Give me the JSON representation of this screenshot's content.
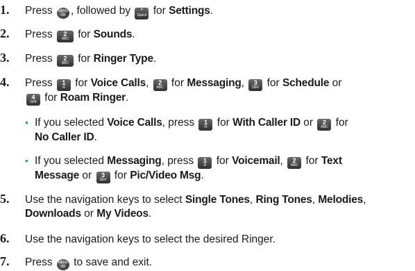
{
  "steps": [
    {
      "n": "1.",
      "t1": "Press ",
      "t2": ", followed by ",
      "t3": " for ",
      "b1": "Settings",
      "t4": "."
    },
    {
      "n": "2.",
      "t1": "Press ",
      "t2": " for ",
      "b1": "Sounds",
      "t3": "."
    },
    {
      "n": "3.",
      "t1": "Press ",
      "t2": " for ",
      "b1": "Ringer Type",
      "t3": "."
    },
    {
      "n": "4.",
      "t1": "Press ",
      "t2": " for ",
      "b1": "Voice Calls",
      "t3": ", ",
      "t4": " for ",
      "b2": "Messaging",
      "t5": ", ",
      "t6": " for ",
      "b3": "Schedule",
      "t7": " or",
      "t8": " for ",
      "b4": "Roam Ringer",
      "t9": "."
    },
    {
      "n": "5.",
      "t1": "Use the navigation keys to select ",
      "b1": "Single Tones",
      "t2": ", ",
      "b2": "Ring Tones",
      "t3": ", ",
      "b3": "Melodies",
      "t4": ",",
      "b4": "Downloads",
      "t5": " or ",
      "b5": "My Videos",
      "t6": "."
    },
    {
      "n": "6.",
      "t1": "Use the navigation keys to select the desired Ringer."
    },
    {
      "n": "7.",
      "t1": "Press ",
      "t2": " to save and exit."
    }
  ],
  "subs": [
    {
      "t1": "If you selected ",
      "b1": "Voice Calls",
      "t2": ", press ",
      "t3": " for ",
      "b2": "With Caller ID",
      "t4": " or ",
      "t5": " for",
      "b3": "No Caller ID",
      "t6": "."
    },
    {
      "t1": "If you selected ",
      "b1": "Messaging",
      "t2": ", press ",
      "t3": " for ",
      "b2": "Voicemail",
      "t4": ", ",
      "t5": " for ",
      "b3": "Text",
      "b4": "Message",
      "t6": " or ",
      "t7": " for ",
      "b5": "Pic/Video Msg",
      "t8": "."
    }
  ],
  "keys": {
    "menu_top": "MENU",
    "menu_bottom": "OK",
    "k1": "1",
    "k2": "2",
    "k3": "3",
    "k4": "4",
    "abc": "ABC",
    "def": "DEF",
    "ghi": "GHI",
    "star": "*",
    "space": "Space"
  },
  "colors": {
    "bullet": "#2a8fd0",
    "key_bg": "#3a3a3a"
  }
}
